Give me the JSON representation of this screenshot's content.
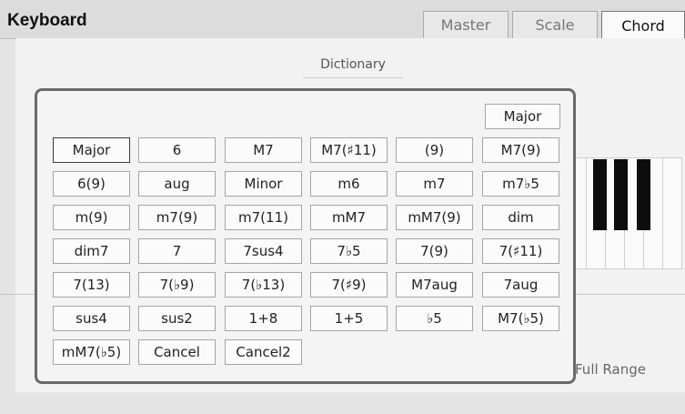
{
  "header": {
    "title": "Keyboard",
    "tabs": [
      {
        "label": "Master",
        "active": false
      },
      {
        "label": "Scale",
        "active": false
      },
      {
        "label": "Chord",
        "active": true
      }
    ]
  },
  "main": {
    "dictionary_label": "Dictionary",
    "range_label": "Full Range"
  },
  "dialog": {
    "top_button": "Major",
    "selected_chord": "Major",
    "chords": [
      [
        "Major",
        "6",
        "M7",
        "M7(♯11)",
        "(9)",
        "M7(9)"
      ],
      [
        "6(9)",
        "aug",
        "Minor",
        "m6",
        "m7",
        "m7♭5"
      ],
      [
        "m(9)",
        "m7(9)",
        "m7(11)",
        "mM7",
        "mM7(9)",
        "dim"
      ],
      [
        "dim7",
        "7",
        "7sus4",
        "7♭5",
        "7(9)",
        "7(♯11)"
      ],
      [
        "7(13)",
        "7(♭9)",
        "7(♭13)",
        "7(♯9)",
        "M7aug",
        "7aug"
      ],
      [
        "sus4",
        "sus2",
        "1+8",
        "1+5",
        "♭5",
        "M7(♭5)"
      ],
      [
        "mM7(♭5)",
        "Cancel",
        "Cancel2"
      ]
    ]
  },
  "colors": {
    "background": "#e4e4e4",
    "panel": "#f2f2f2",
    "dialog_border": "#6a6a6a",
    "black_key": "#0d0d0d"
  }
}
